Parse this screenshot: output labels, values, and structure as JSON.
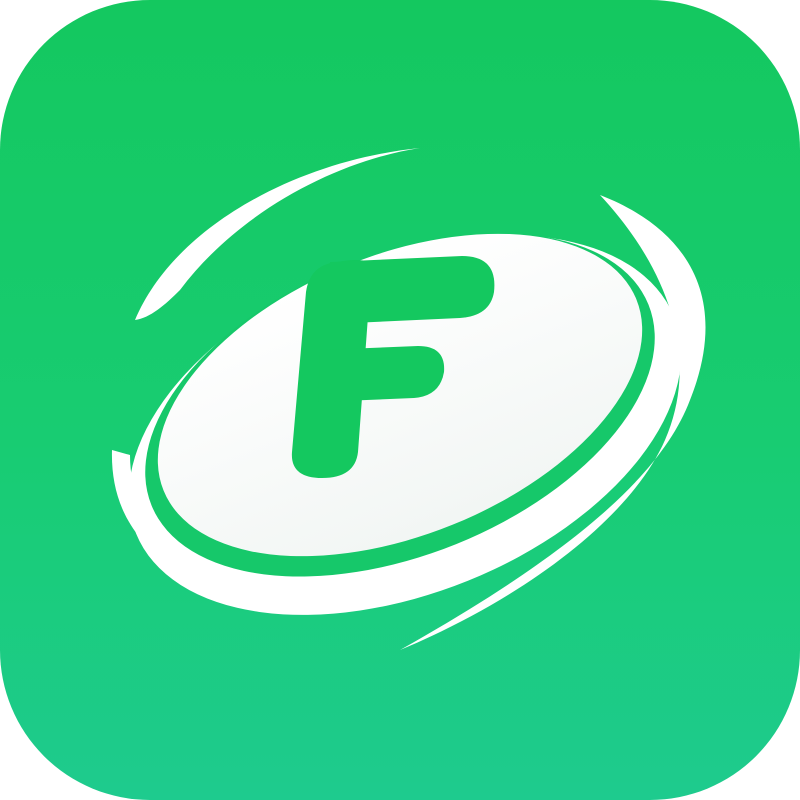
{
  "app_icon": {
    "name": "app-icon",
    "logo_letter": "F",
    "colors": {
      "background_top": "#14c85f",
      "background_bottom": "#1ecb8e",
      "disc": "#ffffff",
      "letter": "#14c85f"
    }
  }
}
